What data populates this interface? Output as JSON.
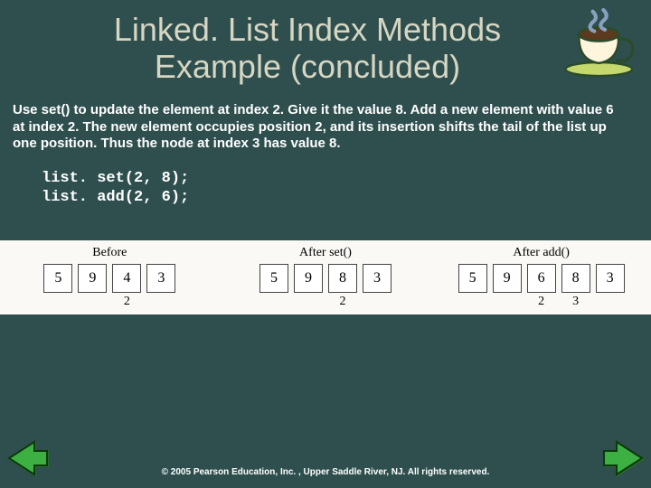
{
  "title_line1": "Linked. List Index Methods",
  "title_line2": "Example (concluded)",
  "description": "Use set() to update the element at index 2. Give it the value 8. Add a new element with value 6 at index 2. The new element occupies position 2, and its insertion shifts the tail of the list up one position. Thus the node at index 3 has value 8.",
  "code": {
    "line1": "list. set(2, 8);",
    "line2": "list. add(2, 6);"
  },
  "figure": {
    "groups": [
      {
        "label": "Before",
        "values": [
          "5",
          "9",
          "4",
          "3"
        ],
        "indices": [
          "",
          "",
          "2",
          ""
        ]
      },
      {
        "label": "After set()",
        "values": [
          "5",
          "9",
          "8",
          "3"
        ],
        "indices": [
          "",
          "",
          "2",
          ""
        ]
      },
      {
        "label": "After add()",
        "values": [
          "5",
          "9",
          "6",
          "8",
          "3"
        ],
        "indices": [
          "",
          "",
          "2",
          "3",
          ""
        ]
      }
    ]
  },
  "copyright": "© 2005 Pearson Education, Inc. , Upper Saddle River, NJ.  All rights reserved."
}
